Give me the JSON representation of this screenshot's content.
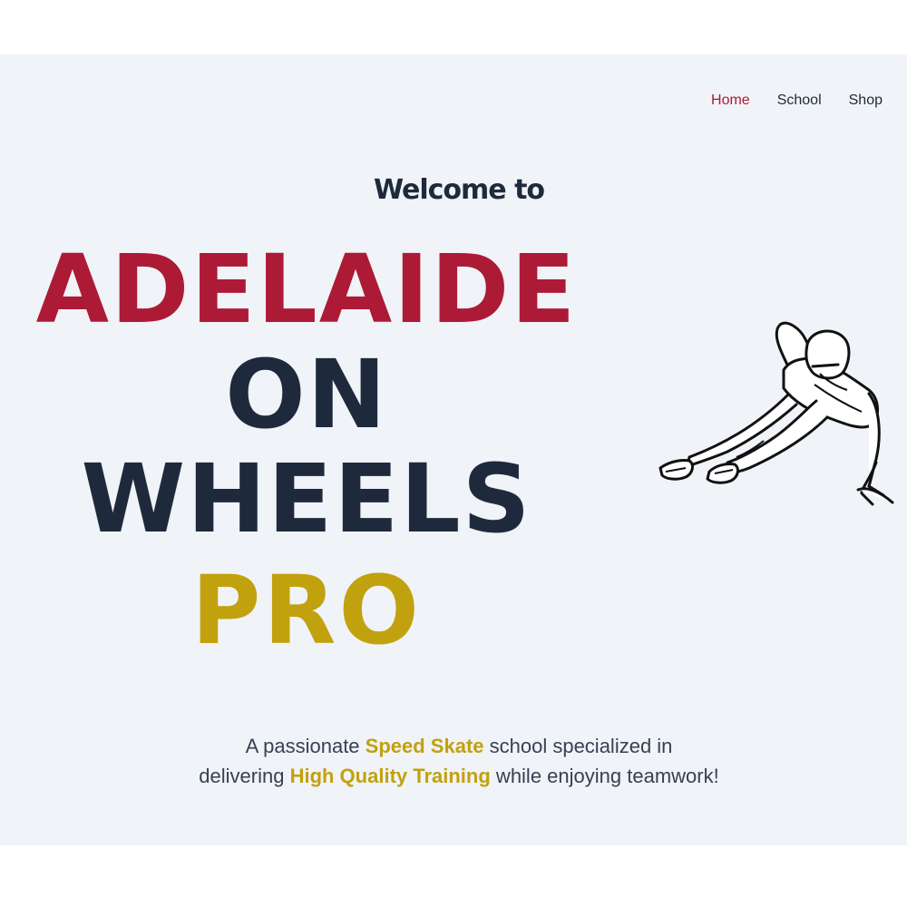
{
  "nav": {
    "items": [
      {
        "label": "Home",
        "active": true
      },
      {
        "label": "School",
        "active": false
      },
      {
        "label": "Shop",
        "active": false
      }
    ]
  },
  "hero": {
    "welcome": "Welcome to",
    "title_lines": [
      "ADELAIDE",
      "ON",
      "WHEELS",
      "PRO"
    ],
    "tagline": {
      "line1_pre": "A passionate ",
      "line1_highlight": "Speed Skate",
      "line1_post": " school specialized in",
      "line2_pre": "delivering ",
      "line2_highlight": "High Quality Training",
      "line2_post": " while enjoying teamwork!"
    },
    "illustration": "speed-skater-illustration"
  },
  "colors": {
    "background": "#f0f3f8",
    "accent_red": "#ad1a35",
    "navy": "#1e2a3c",
    "gold": "#c2a10e"
  }
}
